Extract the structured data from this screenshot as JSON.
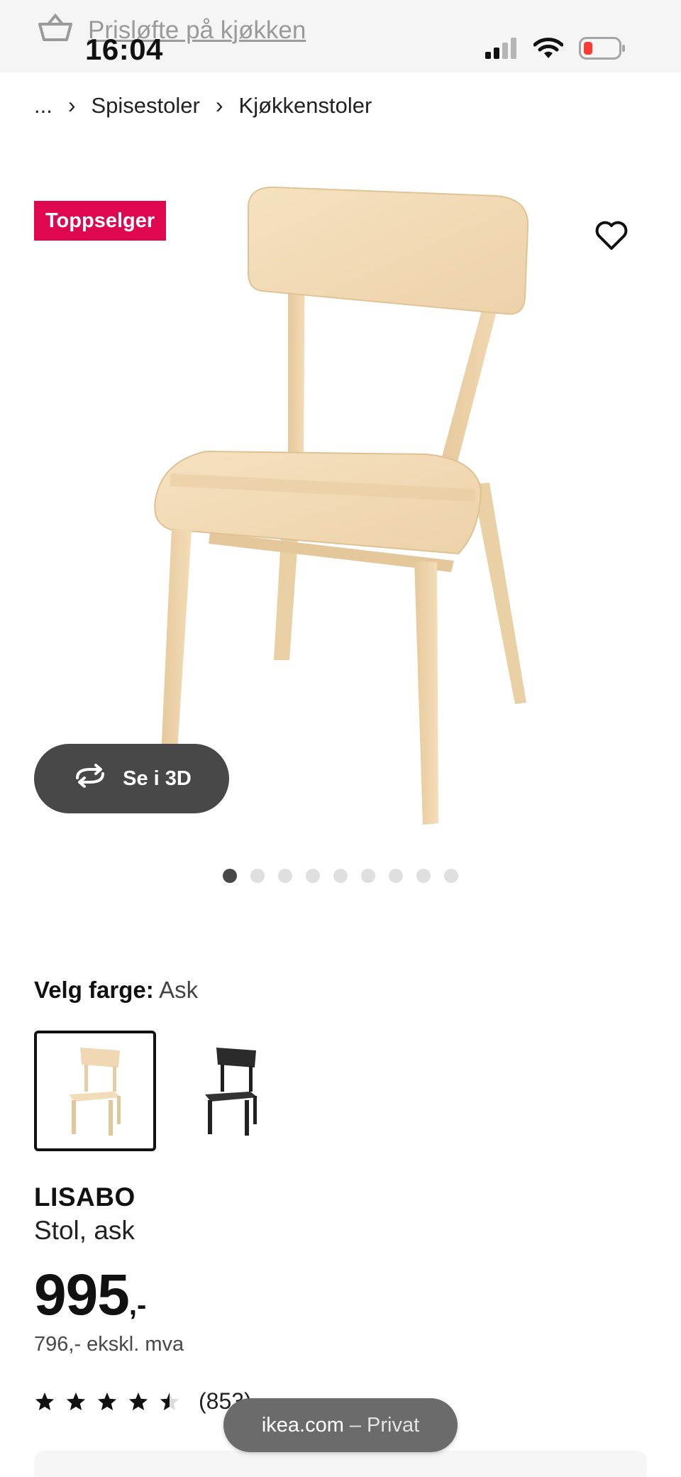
{
  "status_bar": {
    "time": "16:04",
    "promo_text": "Prisløfte på kjøkken"
  },
  "breadcrumb": {
    "ellipsis": "...",
    "items": [
      "Spisestoler",
      "Kjøkkenstoler"
    ]
  },
  "gallery": {
    "badge": "Toppselger",
    "view_3d_label": "Se i 3D",
    "dot_count": 9,
    "active_dot": 1
  },
  "color": {
    "label": "Velg farge:",
    "value": "Ask",
    "options": [
      "ask",
      "svart"
    ]
  },
  "product": {
    "name": "LISABO",
    "description": "Stol, ask",
    "price_int": "995",
    "price_suffix": ",-",
    "price_ex_vat": "796,- ekskl. mva",
    "rating": 4.5,
    "review_count": "(853)"
  },
  "privacy_pill": {
    "site": "ikea.com",
    "mode": "– Privat"
  },
  "colors": {
    "badge": "#e00751",
    "button_dark": "#484848"
  }
}
